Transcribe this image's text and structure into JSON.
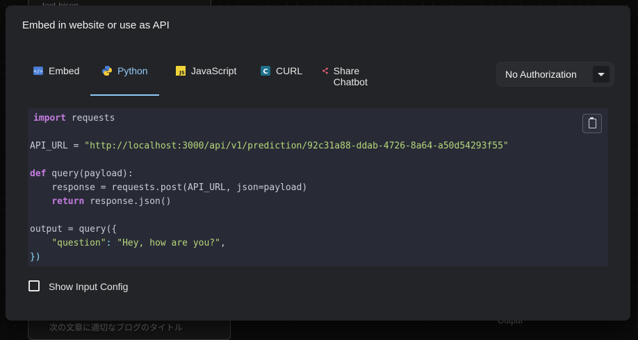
{
  "background": {
    "top_node_text": "text-bison",
    "bottom_node_text": "次の文章に適切なブログのタイトル",
    "bottom_right_text": "Output"
  },
  "modal": {
    "title": "Embed in website or use as API",
    "tabs": [
      {
        "label": "Embed",
        "icon": "embed-icon",
        "active": false
      },
      {
        "label": "Python",
        "icon": "python-icon",
        "active": true
      },
      {
        "label": "JavaScript",
        "icon": "javascript-icon",
        "active": false
      },
      {
        "label": "CURL",
        "icon": "curl-icon",
        "active": false
      },
      {
        "label": "Share Chatbot",
        "icon": "share-icon",
        "active": false
      }
    ],
    "authorization": {
      "selected": "No Authorization"
    },
    "code": {
      "import_kw": "import",
      "import_rest": " requests",
      "api_url_var": "API_URL = ",
      "api_url_value": "\"http://localhost:3000/api/v1/prediction/92c31a88-ddab-4726-8a64-a50d54293f55\"",
      "def_kw": "def",
      "def_rest": " query(payload):",
      "response_line": "    response = requests.post(API_URL, json=payload)",
      "return_indent": "    ",
      "return_kw": "return",
      "return_rest": " response.json()",
      "output_line": "output = query({",
      "question_indent": "    ",
      "question_key": "\"question\"",
      "question_colon": ": ",
      "question_value": "\"Hey, how are you?\"",
      "question_comma": ",",
      "closing": "})"
    },
    "show_input_config": {
      "label": "Show Input Config",
      "checked": false
    }
  }
}
